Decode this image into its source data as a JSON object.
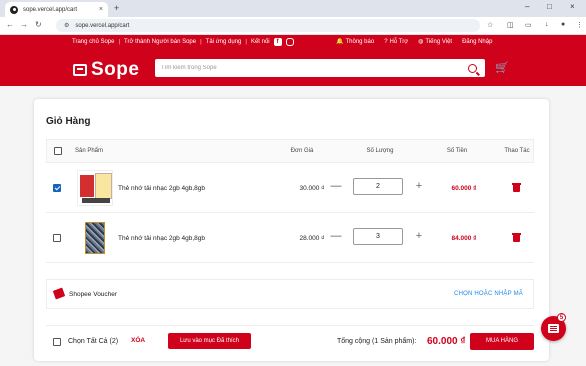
{
  "browser": {
    "tab_title": "sope.vercel.app/cart",
    "url": "sope.vercel.app/cart"
  },
  "header": {
    "topnav": [
      "Trang chủ Sope",
      "Trở thành Người bán Sope",
      "Tải ứng dụng",
      "Kết nối"
    ],
    "notifications": "Thông báo",
    "support": "Hỗ Trợ",
    "language": "Tiếng Việt",
    "login": "Đăng Nhập",
    "logo": "Sope",
    "search_placeholder": "Tìm kiếm trong Sope"
  },
  "cart": {
    "title": "Giỏ Hàng",
    "columns": {
      "product": "Sản Phẩm",
      "unit_price": "Đơn Giá",
      "quantity": "Số Lượng",
      "amount": "Số Tiền",
      "actions": "Thao Tác"
    },
    "items": [
      {
        "name": "Thẻ nhớ tải nhạc 2gb 4gb,8gb",
        "price": "30.000 ₫",
        "quantity": "2",
        "total": "60.000 ₫",
        "checked": true
      },
      {
        "name": "Thẻ nhớ tải nhạc 2gb 4gb,8gb",
        "price": "28.000 ₫",
        "quantity": "3",
        "total": "84.000 ₫",
        "checked": false
      }
    ],
    "voucher": {
      "label": "Shopee Voucher",
      "link": "CHỌN HOẶC NHẬP MÃ"
    },
    "footer": {
      "select_all": "Chọn Tất Cả (2)",
      "delete": "XÓA",
      "save": "Lưu vào mục Đã thích",
      "total_label": "Tổng cộng (1 Sản phẩm):",
      "total_value": "60.000 ₫",
      "buy": "MUA HÀNG"
    }
  },
  "chat": {
    "badge": "5"
  },
  "colors": {
    "brand": "#d0011b",
    "link": "#1e88e5",
    "checkbox": "#1565c0"
  }
}
